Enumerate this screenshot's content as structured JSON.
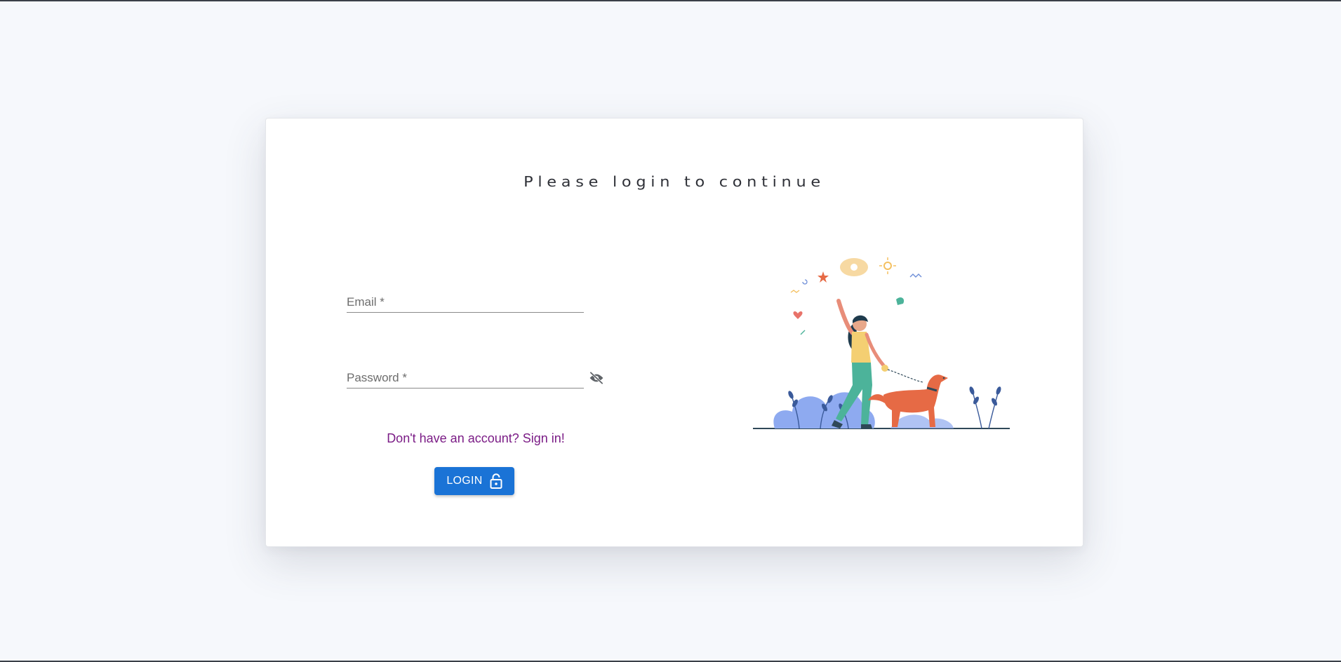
{
  "page": {
    "title": "Please login to continue"
  },
  "form": {
    "email_placeholder": "Email *",
    "email_value": "",
    "password_placeholder": "Password *",
    "password_value": "",
    "signup_link": "Don't have an account? Sign in!",
    "login_label": "LOGIN"
  },
  "icons": {
    "password_toggle": "eye-off-icon",
    "login_button": "lock-open-icon",
    "illustration": "woman-walking-dog-illustration"
  },
  "colors": {
    "background": "#f6f8fc",
    "primary": "#1a73d6",
    "link": "#7b1c86",
    "card": "#ffffff"
  }
}
